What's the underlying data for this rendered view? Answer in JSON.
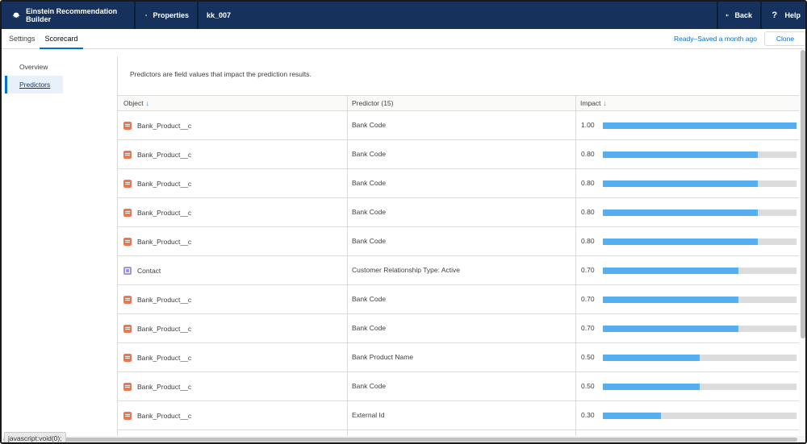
{
  "header": {
    "app_title": "Einstein Recommendation Builder",
    "properties_label": "Properties",
    "record_name": "kk_007",
    "back_label": "Back",
    "help_label": "Help"
  },
  "tabs": [
    {
      "label": "Settings",
      "active": false
    },
    {
      "label": "Scorecard",
      "active": true
    }
  ],
  "status_text": "Ready–Saved a month ago",
  "clone_label": "Clone",
  "sidebar": {
    "items": [
      {
        "label": "Overview",
        "active": false
      },
      {
        "label": "Predictors",
        "active": true
      }
    ]
  },
  "main": {
    "intro": "Predictors are field values that impact the prediction results.",
    "columns": {
      "object": "Object",
      "predictor": "Predictor (15)",
      "impact": "Impact"
    },
    "rows": [
      {
        "object": "Bank_Product__c",
        "object_icon": "bank-product-icon",
        "predictor": "Bank Code",
        "impact": "1.00",
        "impact_value": 1.0
      },
      {
        "object": "Bank_Product__c",
        "object_icon": "bank-product-icon",
        "predictor": "Bank Code",
        "impact": "0.80",
        "impact_value": 0.8
      },
      {
        "object": "Bank_Product__c",
        "object_icon": "bank-product-icon",
        "predictor": "Bank Code",
        "impact": "0.80",
        "impact_value": 0.8
      },
      {
        "object": "Bank_Product__c",
        "object_icon": "bank-product-icon",
        "predictor": "Bank Code",
        "impact": "0.80",
        "impact_value": 0.8
      },
      {
        "object": "Bank_Product__c",
        "object_icon": "bank-product-icon",
        "predictor": "Bank Code",
        "impact": "0.80",
        "impact_value": 0.8
      },
      {
        "object": "Contact",
        "object_icon": "contact-icon",
        "predictor": "Customer Relationship Type: Active",
        "impact": "0.70",
        "impact_value": 0.7
      },
      {
        "object": "Bank_Product__c",
        "object_icon": "bank-product-icon",
        "predictor": "Bank Code",
        "impact": "0.70",
        "impact_value": 0.7
      },
      {
        "object": "Bank_Product__c",
        "object_icon": "bank-product-icon",
        "predictor": "Bank Code",
        "impact": "0.70",
        "impact_value": 0.7
      },
      {
        "object": "Bank_Product__c",
        "object_icon": "bank-product-icon",
        "predictor": "Bank Product Name",
        "impact": "0.50",
        "impact_value": 0.5
      },
      {
        "object": "Bank_Product__c",
        "object_icon": "bank-product-icon",
        "predictor": "Bank Code",
        "impact": "0.50",
        "impact_value": 0.5
      },
      {
        "object": "Bank_Product__c",
        "object_icon": "bank-product-icon",
        "predictor": "External Id",
        "impact": "0.30",
        "impact_value": 0.3
      }
    ]
  },
  "status_bar_text": "javascript:void(0);",
  "colors": {
    "header_bg": "#16325c",
    "accent": "#0070d2",
    "bar_fill": "#55aef0",
    "bar_track": "#dcdcdc",
    "bank_icon": "#f2754e",
    "contact_icon": "#a094ed"
  }
}
